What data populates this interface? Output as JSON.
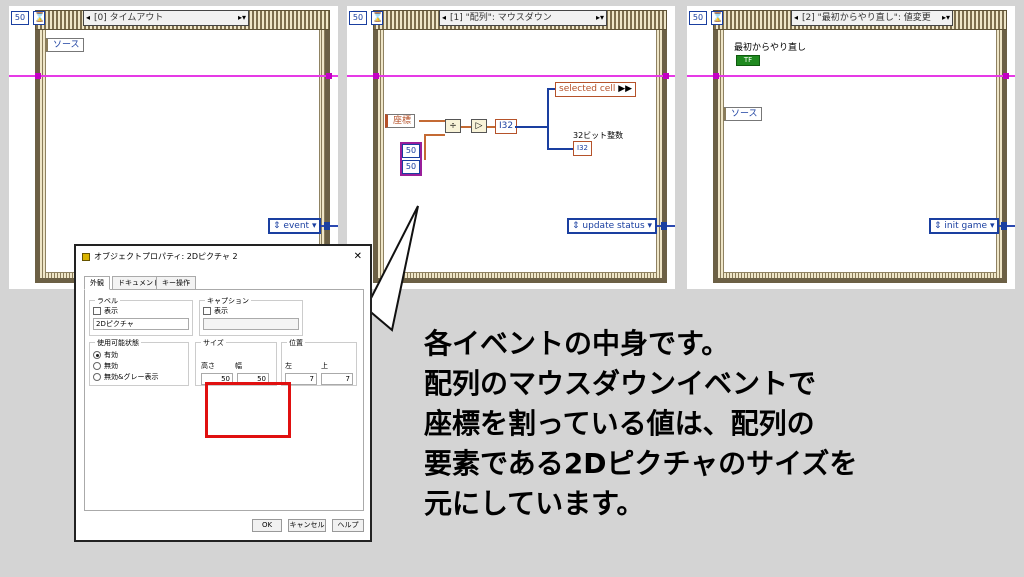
{
  "diagram1": {
    "loop_count": "50",
    "selector_label": "[0] タイムアウト",
    "source_label": "ソース",
    "enum_label": "event"
  },
  "diagram2": {
    "loop_count": "50",
    "selector_label": "[1] \"配列\": マウスダウン",
    "coord_label": "座標",
    "const_a": "50",
    "const_b": "50",
    "cast_label": "I32",
    "selected_cell_label": "selected cell",
    "int32_label": "32ビット整数",
    "int32_node": "I32",
    "enum_label": "update status"
  },
  "diagram3": {
    "loop_count": "50",
    "selector_label": "[2] \"最初からやり直し\": 値変更",
    "button_label": "最初からやり直し",
    "tf_label": "TF",
    "source_label": "ソース",
    "enum_label": "init game"
  },
  "dialog": {
    "title": "オブジェクトプロパティ: 2Dピクチャ 2",
    "close": "✕",
    "tabs": [
      "外観",
      "ドキュメント",
      "キー操作"
    ],
    "label_group": "ラベル",
    "label_show": "表示",
    "label_value": "2Dピクチャ",
    "caption_group": "キャプション",
    "caption_show": "表示",
    "state_group": "使用可能状態",
    "state_options": [
      "有効",
      "無効",
      "無効&グレー表示"
    ],
    "size_group": "サイズ",
    "height_label": "高さ",
    "width_label": "幅",
    "height_value": "50",
    "width_value": "50",
    "position_group": "位置",
    "left_label": "左",
    "top_label": "上",
    "left_value": "7",
    "top_value": "7",
    "ok": "OK",
    "cancel": "キャンセル",
    "help": "ヘルプ"
  },
  "caption_lines": [
    "各イベントの中身です。",
    "配列のマウスダウンイベントで",
    "座標を割っている値は、配列の",
    "要素である2Dピクチャのサイズを",
    "元にしています。"
  ]
}
